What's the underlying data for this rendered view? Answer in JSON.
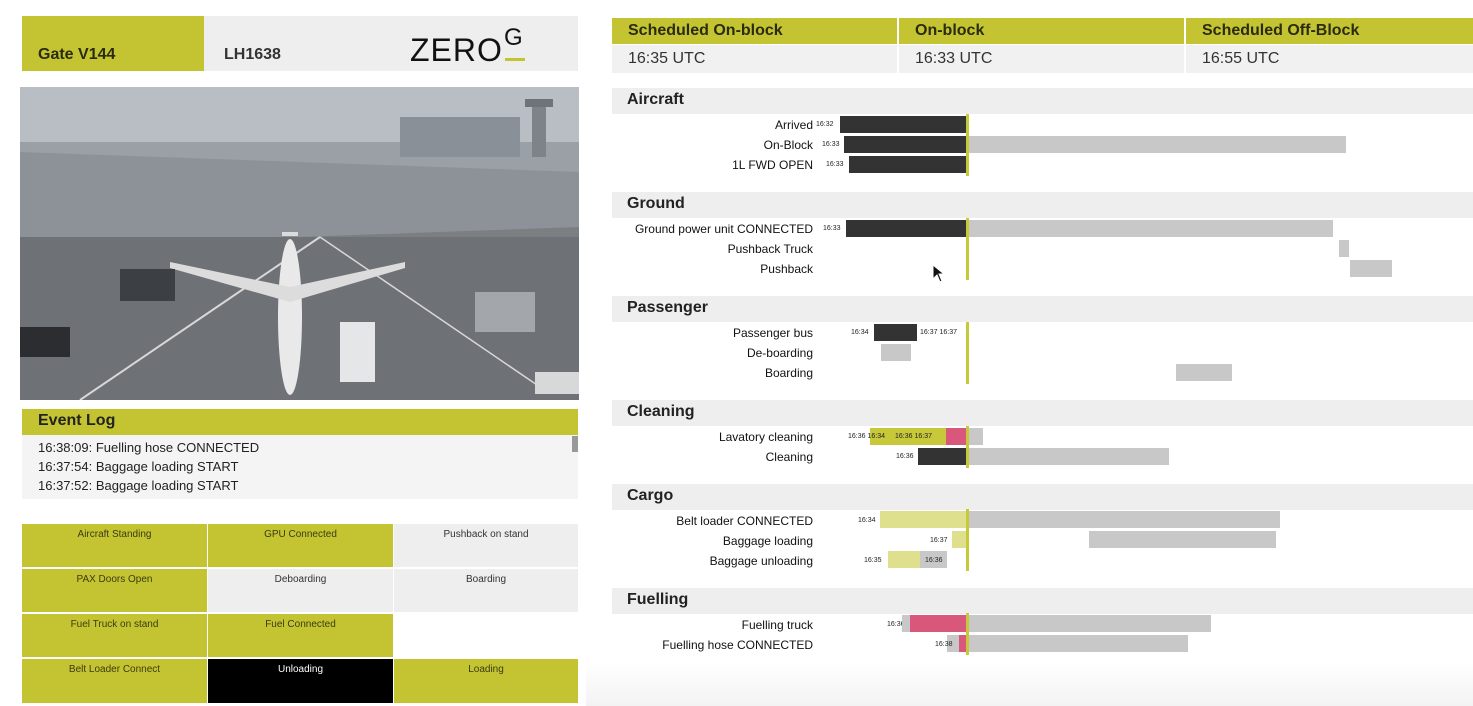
{
  "header": {
    "gate": "Gate V144",
    "flight": "LH1638",
    "logo_text": "ZERO",
    "logo_sup": "G"
  },
  "schedule": {
    "columns": [
      {
        "label": "Scheduled On-block",
        "value": "16:35 UTC"
      },
      {
        "label": "On-block",
        "value": "16:33 UTC"
      },
      {
        "label": "Scheduled Off-Block",
        "value": "16:55 UTC"
      }
    ]
  },
  "event_log": {
    "title": "Event Log",
    "entries": [
      "16:38:09: Fuelling hose CONNECTED",
      "16:37:54: Baggage loading START",
      "16:37:52: Baggage loading START"
    ]
  },
  "status_tiles": [
    {
      "label": "Aircraft Standing",
      "state": "active"
    },
    {
      "label": "GPU Connected",
      "state": "active"
    },
    {
      "label": "Pushback on stand",
      "state": "inactive"
    },
    {
      "label": "PAX Doors Open",
      "state": "active"
    },
    {
      "label": "Deboarding",
      "state": "inactive"
    },
    {
      "label": "Boarding",
      "state": "inactive"
    },
    {
      "label": "Fuel Truck on stand",
      "state": "active"
    },
    {
      "label": "Fuel Connected",
      "state": "active"
    },
    {
      "label": "",
      "state": "empty"
    },
    {
      "label": "Belt Loader Connect",
      "state": "active"
    },
    {
      "label": "Unloading",
      "state": "in-progress"
    },
    {
      "label": "Loading",
      "state": "active"
    }
  ],
  "timeline": {
    "sections": [
      {
        "title": "Aircraft",
        "rows": [
          {
            "label": "Arrived",
            "start": "16:32"
          },
          {
            "label": "On-Block",
            "start": "16:33"
          },
          {
            "label": "1L FWD OPEN",
            "start": "16:33"
          }
        ]
      },
      {
        "title": "Ground",
        "rows": [
          {
            "label": "Ground power unit CONNECTED",
            "start": "16:33"
          },
          {
            "label": "Pushback Truck",
            "start": ""
          },
          {
            "label": "Pushback",
            "start": ""
          }
        ]
      },
      {
        "title": "Passenger",
        "rows": [
          {
            "label": "Passenger bus",
            "start": "16:34",
            "end_labels": "16:37 16:37"
          },
          {
            "label": "De-boarding",
            "start": ""
          },
          {
            "label": "Boarding",
            "start": ""
          }
        ]
      },
      {
        "title": "Cleaning",
        "rows": [
          {
            "label": "Lavatory cleaning",
            "start": "16:36 16:34",
            "mid_labels": "16:36 16:37"
          },
          {
            "label": "Cleaning",
            "start": "16:36"
          }
        ]
      },
      {
        "title": "Cargo",
        "rows": [
          {
            "label": "Belt loader CONNECTED",
            "start": "16:34"
          },
          {
            "label": "Baggage loading",
            "start": "16:37"
          },
          {
            "label": "Baggage unloading",
            "start": "16:35",
            "mid_labels": "16:36"
          }
        ]
      },
      {
        "title": "Fuelling",
        "rows": [
          {
            "label": "Fuelling truck",
            "start": "16:36"
          },
          {
            "label": "Fuelling hose CONNECTED",
            "start": "16:38"
          }
        ]
      }
    ]
  },
  "colors": {
    "accent": "#c4c433",
    "actual": "#333333",
    "planned": "#c8c8c8",
    "late": "#d9577a",
    "panel": "#eeeeee"
  }
}
